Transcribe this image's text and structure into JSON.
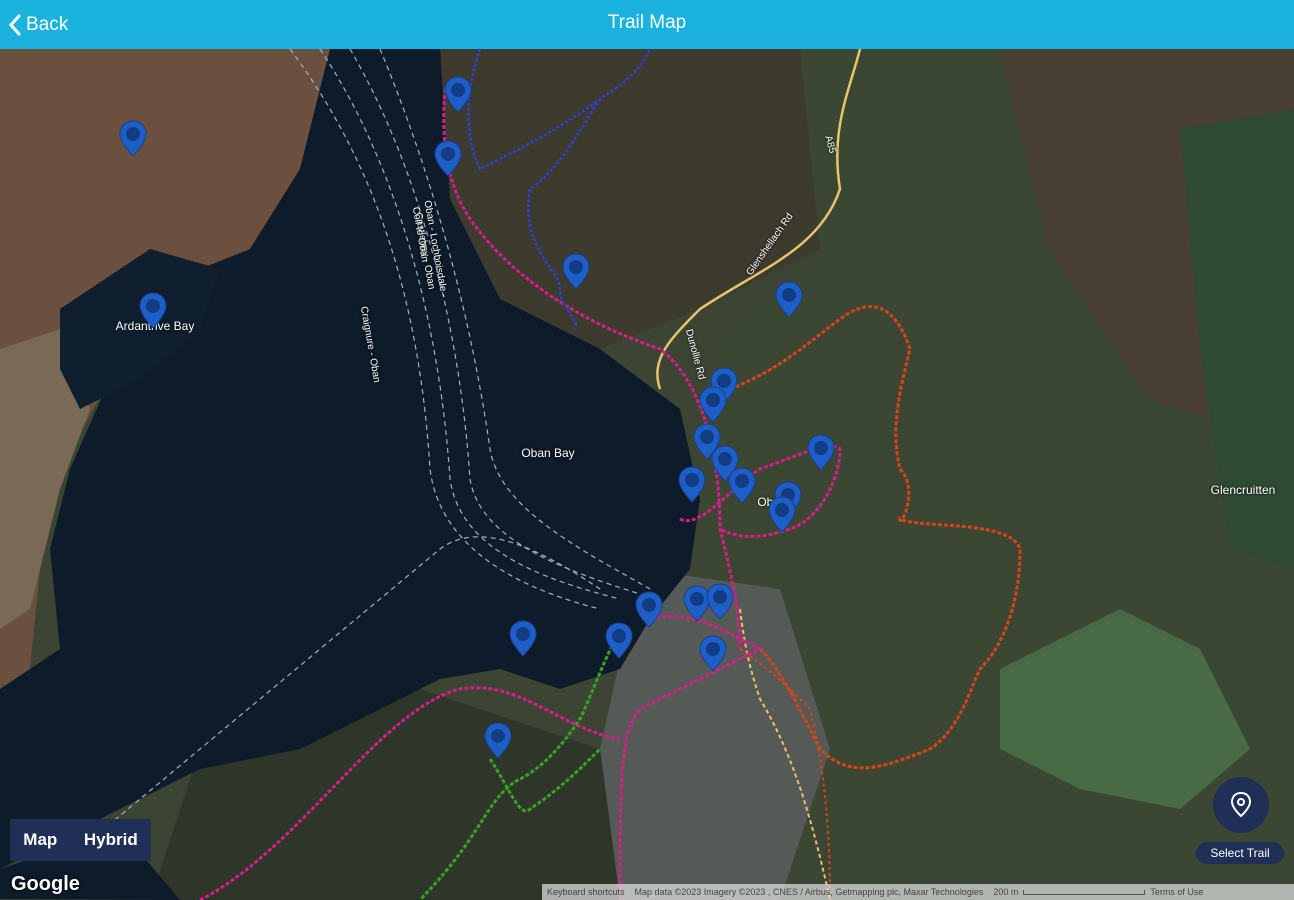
{
  "header": {
    "back_label": "Back",
    "title": "Trail Map"
  },
  "map": {
    "labels": {
      "ardantrive": "Ardantrive Bay",
      "oban_bay": "Oban Bay",
      "ferry1": "Oban - Lochboisdale - Castlebay - Oban",
      "ferry2": "Craignure - Oban",
      "ferry3": "Coll to Oban",
      "glencruitten": "Glencruitten",
      "road1": "A85",
      "road2": "Glenshellach Rd",
      "road3": "Dunollie Rd",
      "town": "Oban"
    },
    "colors": {
      "header": "#1bb3dd",
      "pin": "#1d5ec9",
      "panel": "#1f2f55"
    }
  },
  "toggle": {
    "map": "Map",
    "hybrid": "Hybrid"
  },
  "logo": "Google",
  "attribution": {
    "shortcuts": "Keyboard shortcuts",
    "mapdata": "Map data ©2023 Imagery ©2023 , CNES / Airbus, Getmapping plc, Maxar Technologies",
    "scale": "200 m",
    "terms": "Terms of Use"
  },
  "select_trail": {
    "label": "Select Trail",
    "icon": "location-pin-icon"
  }
}
